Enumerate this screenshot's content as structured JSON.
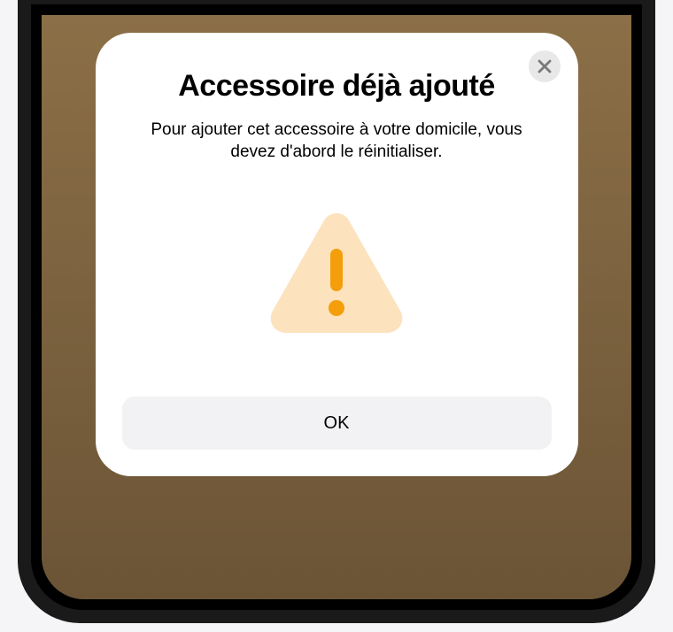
{
  "modal": {
    "title": "Accessoire déjà ajouté",
    "body": "Pour ajouter cet accessoire à votre domicile, vous devez d'abord le réinitialiser.",
    "ok_label": "OK"
  }
}
